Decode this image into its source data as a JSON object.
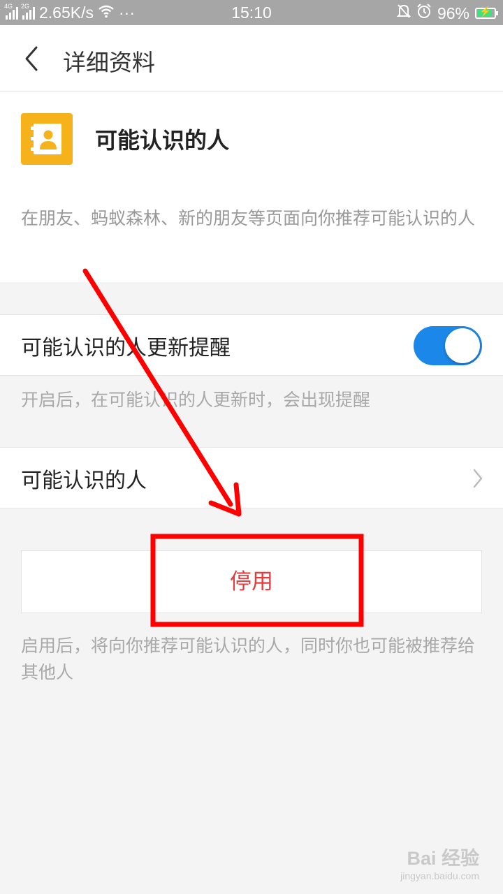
{
  "status_bar": {
    "network_1": "4G",
    "network_2": "2G",
    "speed": "2.65K/s",
    "more": "···",
    "time": "15:10",
    "battery": "96%",
    "battery_level": 0.96
  },
  "nav": {
    "title": "详细资料"
  },
  "app": {
    "name": "可能认识的人",
    "description": "在朋友、蚂蚁森林、新的朋友等页面向你推荐可能认识的人",
    "icon_color": "#f6b21b"
  },
  "settings": {
    "update_reminder": {
      "label": "可能认识的人更新提醒",
      "enabled": true,
      "hint": "开启后，在可能认识的人更新时，会出现提醒"
    },
    "people_link": {
      "label": "可能认识的人"
    },
    "disable_button": {
      "label": "停用"
    },
    "footer_hint": "启用后，将向你推荐可能认识的人，同时你也可能被推荐给其他人"
  },
  "annotation": {
    "color": "#ff0000"
  },
  "watermark": {
    "main": "Bai 经验",
    "sub": "jingyan.baidu.com"
  }
}
